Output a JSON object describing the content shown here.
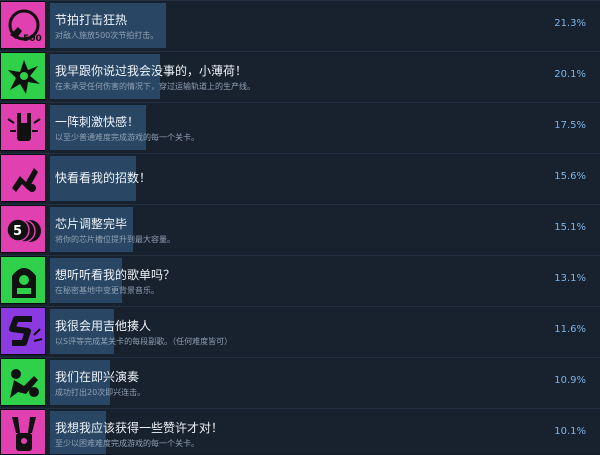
{
  "achievements": [
    {
      "title": "节拍打击狂热",
      "desc": "对敌人施放500次节拍打击。",
      "percent": "21.3%",
      "percent_value": 21.3,
      "icon": "500-beat-hit-icon",
      "color": "#e040b0"
    },
    {
      "title": "我早跟你说过我会没事的，小薄荷！",
      "desc": "在未承受任何伤害的情况下，穿过运输轨道上的生产线。",
      "percent": "20.1%",
      "percent_value": 20.1,
      "icon": "character-spin-icon",
      "color": "#2fd04a"
    },
    {
      "title": "一阵刺激快感！",
      "desc": "以至少普通难度完成游戏的每一个关卡。",
      "percent": "17.5%",
      "percent_value": 17.5,
      "icon": "rock-hand-icon",
      "color": "#e040b0"
    },
    {
      "title": "快看看我的招数！",
      "desc": "",
      "percent": "15.6%",
      "percent_value": 15.6,
      "icon": "combo-move-icon",
      "color": "#e040b0"
    },
    {
      "title": "芯片调整完毕",
      "desc": "将你的芯片槽位提升到最大容量。",
      "percent": "15.1%",
      "percent_value": 15.1,
      "icon": "chip-5-icon",
      "color": "#e040b0"
    },
    {
      "title": "想听听看我的歌单吗？",
      "desc": "在秘密基地中变更背景音乐。",
      "percent": "13.1%",
      "percent_value": 13.1,
      "icon": "jukebox-icon",
      "color": "#2fd04a"
    },
    {
      "title": "我很会用吉他揍人",
      "desc": "以S评等完成某关卡的每段副歌。（任何难度皆可）",
      "percent": "11.6%",
      "percent_value": 11.6,
      "icon": "s-rank-icon",
      "color": "#8a3ae0"
    },
    {
      "title": "我们在即兴演奏",
      "desc": "成功打出20次即兴连击。",
      "percent": "10.9%",
      "percent_value": 10.9,
      "icon": "jam-pose-icon",
      "color": "#2fd04a"
    },
    {
      "title": "我想我应该获得一些赞许才对！",
      "desc": "至少以困难难度完成游戏的每一个关卡。",
      "percent": "10.1%",
      "percent_value": 10.1,
      "icon": "hands-up-icon",
      "color": "#e040b0"
    }
  ]
}
